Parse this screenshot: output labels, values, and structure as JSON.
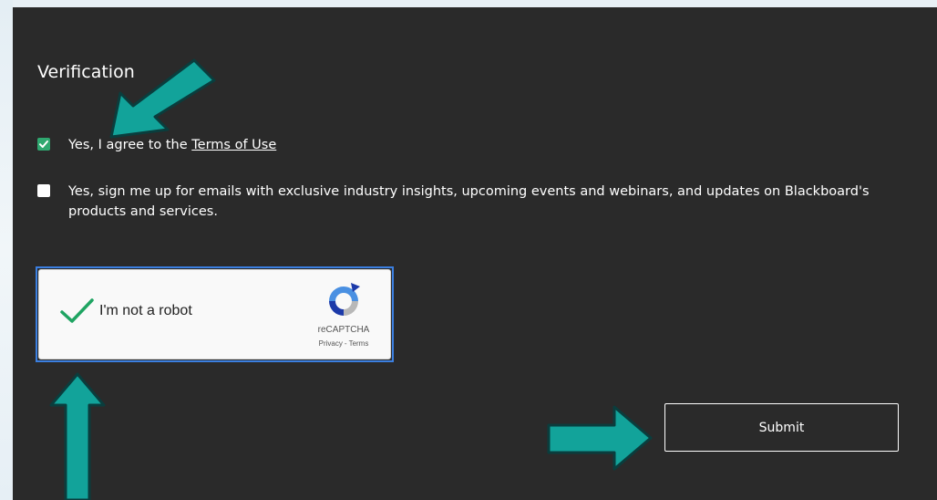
{
  "verification": {
    "title": "Verification",
    "terms_prefix": "Yes, I agree to the ",
    "terms_link": "Terms of Use",
    "emails_text": "Yes, sign me up for emails with exclusive industry insights, upcoming events and webinars, and updates on Blackboard's products and services.",
    "terms_checked": true,
    "emails_checked": false
  },
  "recaptcha": {
    "label": "I'm not a robot",
    "brand": "reCAPTCHA",
    "privacy": "Privacy",
    "separator": "-",
    "terms": "Terms",
    "checked": true
  },
  "submit": {
    "label": "Submit"
  },
  "colors": {
    "panel": "#2a2a2a",
    "checkbox_green": "#2fa870",
    "annotation_arrow": "#12a39a",
    "recaptcha_focus": "#3b7fe0"
  },
  "annotations": {
    "icons": [
      "arrow-down-left-icon",
      "arrow-up-icon",
      "arrow-right-icon"
    ]
  }
}
